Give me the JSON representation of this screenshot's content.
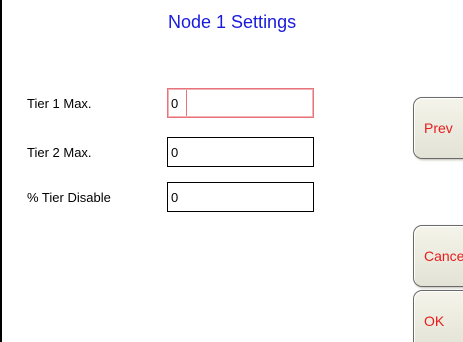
{
  "header": {
    "title": "Node 1 Settings"
  },
  "form": {
    "fields": [
      {
        "label": "Tier 1 Max.",
        "value": "0"
      },
      {
        "label": "Tier 2 Max.",
        "value": "0"
      },
      {
        "label": "% Tier Disable",
        "value": "0"
      }
    ]
  },
  "buttons": {
    "prev": "Prev",
    "cancel": "Cance",
    "ok": "OK"
  },
  "colors": {
    "title": "#1a1adc",
    "button_text": "#e81c1c",
    "active_field_border": "#e8737a"
  }
}
